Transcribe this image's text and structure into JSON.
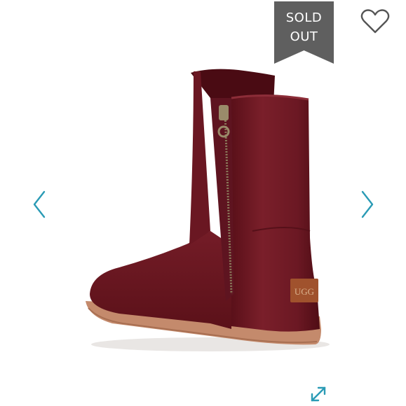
{
  "badge": {
    "line1": "SOLD",
    "line2": "OUT",
    "color": "#5f5f5f"
  },
  "icons": {
    "favorite": "heart-outline-icon",
    "prev": "chevron-left-icon",
    "next": "chevron-right-icon",
    "expand": "expand-arrows-icon"
  },
  "colors": {
    "accent": "#2a9bb5",
    "boot": "#6e1a24",
    "sole": "#c48a6c",
    "label": "#a0522d"
  },
  "product": {
    "logo_text": "UGG"
  }
}
